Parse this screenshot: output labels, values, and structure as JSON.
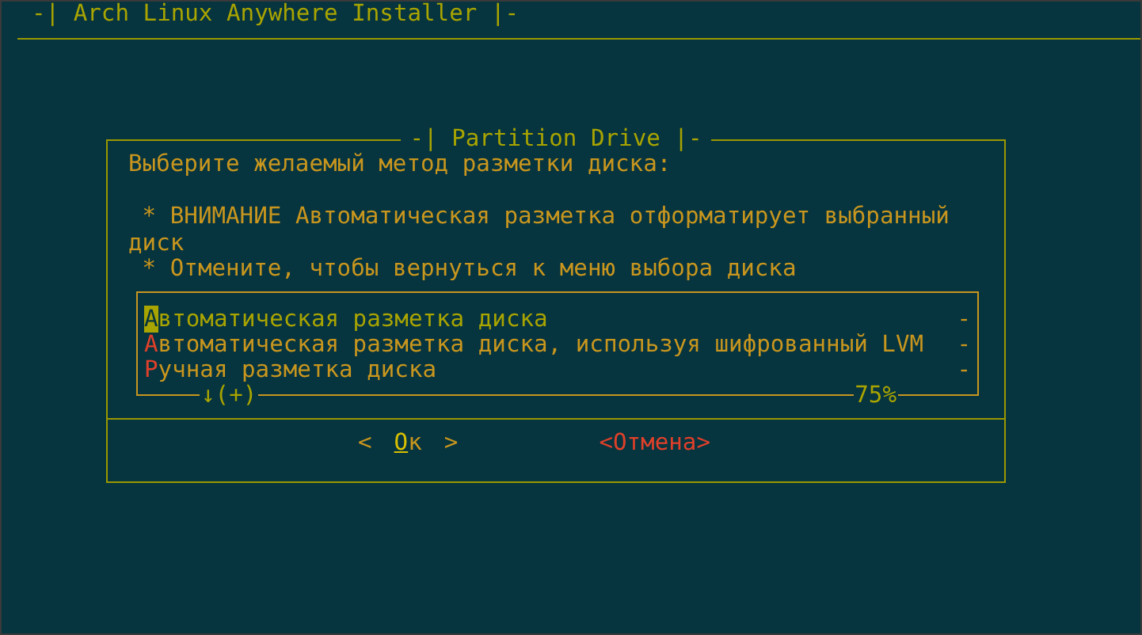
{
  "window": {
    "title": "-| Arch Linux Anywhere Installer |-"
  },
  "dialog": {
    "title": "-| Partition Drive |-",
    "prompt": "Выберите желаемый метод разметки диска:",
    "notes": [
      "* ВНИМАНИЕ Автоматическая разметка отформатирует выбранный диск",
      "* Отмените, чтобы вернуться к меню выбора диска"
    ],
    "menu": {
      "items": [
        {
          "label": "Автоматическая разметка диска",
          "marker": "-",
          "selected": true
        },
        {
          "label": "Автоматическая разметка диска, используя шифрованный LVM",
          "marker": "-",
          "selected": false
        },
        {
          "label": "Ручная разметка диска",
          "marker": "-",
          "selected": false
        }
      ],
      "scroll_indicator": "↓(+)",
      "percent": "75%"
    },
    "buttons": [
      {
        "label": "Ок",
        "left": "<",
        "right": ">",
        "selected": true
      },
      {
        "label": "<Отмена>",
        "selected": false
      }
    ]
  }
}
